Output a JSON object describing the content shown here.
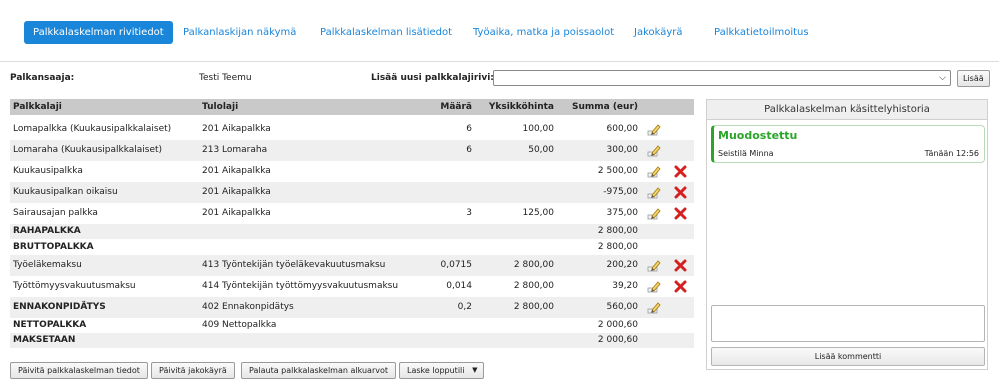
{
  "tabs": [
    {
      "label": "Palkkalaskelman rivitiedot",
      "active": true
    },
    {
      "label": "Palkanlaskijan näkymä"
    },
    {
      "label": "Palkkalaskelman lisätiedot"
    },
    {
      "label": "Työaika, matka ja poissaolot"
    },
    {
      "label": "Jakokäyrä"
    },
    {
      "label": "Palkkatietoilmoitus"
    }
  ],
  "recipient": {
    "label": "Palkansaaja:",
    "name": "Testi Teemu"
  },
  "add_row": {
    "label": "Lisää uusi palkkalajirivi:",
    "select_value": "",
    "button": "Lisää"
  },
  "table": {
    "headers": {
      "palkkalaji": "Palkkalaji",
      "tulolaji": "Tulolaji",
      "maara": "Määrä",
      "yksikkohinta": "Yksikköhinta",
      "summa": "Summa (eur)"
    },
    "rows": [
      {
        "palkkalaji": "Lomapalkka (Kuukausipalkkalaiset)",
        "tulolaji": "201 Aikapalkka",
        "maara": "6",
        "yksikkohinta": "100,00",
        "summa": "600,00",
        "edit": true,
        "delete": false,
        "bold": false
      },
      {
        "palkkalaji": "Lomaraha (Kuukausipalkkalaiset)",
        "tulolaji": "213 Lomaraha",
        "maara": "6",
        "yksikkohinta": "50,00",
        "summa": "300,00",
        "edit": true,
        "delete": false,
        "bold": false
      },
      {
        "palkkalaji": "Kuukausipalkka",
        "tulolaji": "201 Aikapalkka",
        "maara": "",
        "yksikkohinta": "",
        "summa": "2 500,00",
        "edit": true,
        "delete": true,
        "bold": false
      },
      {
        "palkkalaji": "Kuukausipalkan oikaisu",
        "tulolaji": "201 Aikapalkka",
        "maara": "",
        "yksikkohinta": "",
        "summa": "-975,00",
        "edit": true,
        "delete": true,
        "bold": false
      },
      {
        "palkkalaji": "Sairausajan palkka",
        "tulolaji": "201 Aikapalkka",
        "maara": "3",
        "yksikkohinta": "125,00",
        "summa": "375,00",
        "edit": true,
        "delete": true,
        "bold": false
      },
      {
        "palkkalaji": "RAHAPALKKA",
        "tulolaji": "",
        "maara": "",
        "yksikkohinta": "",
        "summa": "2 800,00",
        "edit": false,
        "delete": false,
        "bold": true
      },
      {
        "palkkalaji": "BRUTTOPALKKA",
        "tulolaji": "",
        "maara": "",
        "yksikkohinta": "",
        "summa": "2 800,00",
        "edit": false,
        "delete": false,
        "bold": true
      },
      {
        "palkkalaji": "Työeläkemaksu",
        "tulolaji": "413 Työntekijän työeläkevakuutusmaksu",
        "maara": "0,0715",
        "yksikkohinta": "2 800,00",
        "summa": "200,20",
        "edit": true,
        "delete": true,
        "bold": false
      },
      {
        "palkkalaji": "Työttömyysvakuutusmaksu",
        "tulolaji": "414 Työntekijän työttömyysvakuutusmaksu",
        "maara": "0,014",
        "yksikkohinta": "2 800,00",
        "summa": "39,20",
        "edit": true,
        "delete": true,
        "bold": false
      },
      {
        "palkkalaji": "ENNAKONPIDÄTYS",
        "tulolaji": "402 Ennakonpidätys",
        "maara": "0,2",
        "yksikkohinta": "2 800,00",
        "summa": "560,00",
        "edit": true,
        "delete": false,
        "bold": true
      },
      {
        "palkkalaji": "NETTOPALKKA",
        "tulolaji": "409 Nettopalkka",
        "maara": "",
        "yksikkohinta": "",
        "summa": "2 000,60",
        "edit": false,
        "delete": false,
        "bold": true
      },
      {
        "palkkalaji": "MAKSETAAN",
        "tulolaji": "",
        "maara": "",
        "yksikkohinta": "",
        "summa": "2 000,60",
        "edit": false,
        "delete": false,
        "bold": true
      }
    ]
  },
  "actions": {
    "update": "Päivitä palkkalaskelman tiedot",
    "update_curve": "Päivitä jakokäyrä",
    "restore": "Palauta palkkalaskelman alkuarvot",
    "calc": "Laske lopputili"
  },
  "history": {
    "title": "Palkkalaskelman käsittelyhistoria",
    "entries": [
      {
        "status": "Muodostettu",
        "user": "Seistilä Minna",
        "time": "Tänään 12:56"
      }
    ],
    "comment_value": "",
    "add_comment": "Lisää kommentti"
  },
  "colors": {
    "accent": "#1a86d9",
    "status_green": "#2aa52a",
    "delete_red": "#d62020",
    "header_gray": "#c9c9c9"
  }
}
